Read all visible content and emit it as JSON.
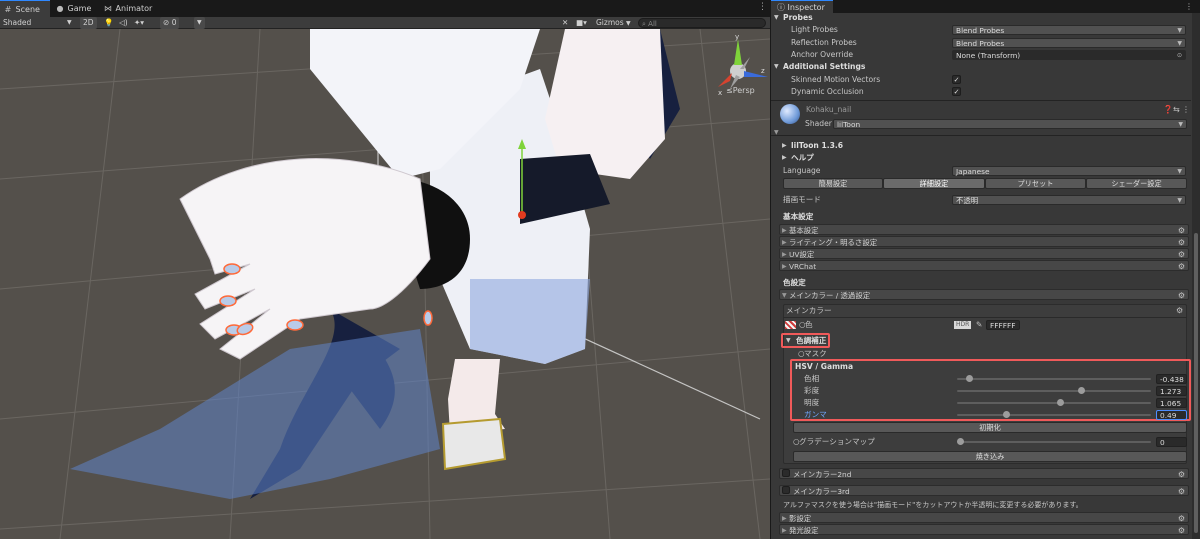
{
  "scene_tabs": [
    {
      "label": "Scene",
      "icon": "hash-icon"
    },
    {
      "label": "Game",
      "icon": "gamepad-icon"
    },
    {
      "label": "Animator",
      "icon": "animator-icon"
    }
  ],
  "scene_toolbar": {
    "shading_mode": "Shaded",
    "mode_2d": "2D",
    "hidden_count": "0",
    "gizmos_label": "Gizmos",
    "search_placeholder": "All"
  },
  "viewport": {
    "projection_label": "Persp",
    "axis_labels": {
      "x": "x",
      "y": "y",
      "z": "z"
    },
    "colors": {
      "axis_x": "#d6432f",
      "axis_y": "#7fd33a",
      "axis_z": "#3a6bdb",
      "nail_outline": "#ff6a3a",
      "background": "#54504b"
    }
  },
  "inspector": {
    "tab_label": "Inspector",
    "probes": {
      "header": "Probes",
      "light_probes_label": "Light Probes",
      "light_probes_value": "Blend Probes",
      "reflection_probes_label": "Reflection Probes",
      "reflection_probes_value": "Blend Probes",
      "anchor_override_label": "Anchor Override",
      "anchor_override_value": "None (Transform)"
    },
    "additional_settings": {
      "header": "Additional Settings",
      "skinned_motion_vectors_label": "Skinned Motion Vectors",
      "skinned_motion_vectors": true,
      "dynamic_occlusion_label": "Dynamic Occlusion",
      "dynamic_occlusion": true
    },
    "material": {
      "name": "Kohaku_nail",
      "shader_label": "Shader",
      "shader_value": "lilToon"
    },
    "liltoon": {
      "version": "lilToon 1.3.6",
      "help_label": "ヘルプ",
      "language_label": "Language",
      "language_value": "Japanese",
      "mode_tabs": [
        "簡易設定",
        "詳細設定",
        "プリセット",
        "シェーダー設定"
      ],
      "active_tab": "詳細設定",
      "render_mode_label": "描画モード",
      "render_mode_value": "不透明",
      "basic_header": "基本設定",
      "basic_foldouts": [
        "基本設定",
        "ライティング・明るさ設定",
        "UV設定",
        "VRChat"
      ],
      "color_header": "色設定",
      "main_color_foldout": "メインカラー / 透過設定",
      "main_color_box_label": "メインカラー",
      "color_label": "色",
      "hdr_label": "HDR",
      "color_hex": "FFFFFF",
      "color_correction_label": "色調補正",
      "mask_label": "マスク",
      "hsv_header": "HSV / Gamma",
      "hsv": [
        {
          "label": "色相",
          "value": "-0.438",
          "slider": 0.06
        },
        {
          "label": "彩度",
          "value": "1.273",
          "slider": 0.64
        },
        {
          "label": "明度",
          "value": "1.065",
          "slider": 0.53
        },
        {
          "label": "ガンマ",
          "value": "0.49",
          "slider": 0.25
        }
      ],
      "reset_button": "初期化",
      "gradation_map_label": "グラデーションマップ",
      "gradation_map_value": "0",
      "gradation_slider": 0.0,
      "bake_button": "焼き込み",
      "main_color_2nd": "メインカラー2nd",
      "main_color_3rd": "メインカラー3rd",
      "alpha_mask_note": "アルファマスクを使う場合は\"描画モード\"をカットアウトか半透明に変更する必要があります。",
      "bottom_foldouts": [
        "影設定",
        "発光設定"
      ]
    },
    "colors": {
      "highlight": "#f05a5a",
      "accent": "#2f88ff"
    }
  }
}
